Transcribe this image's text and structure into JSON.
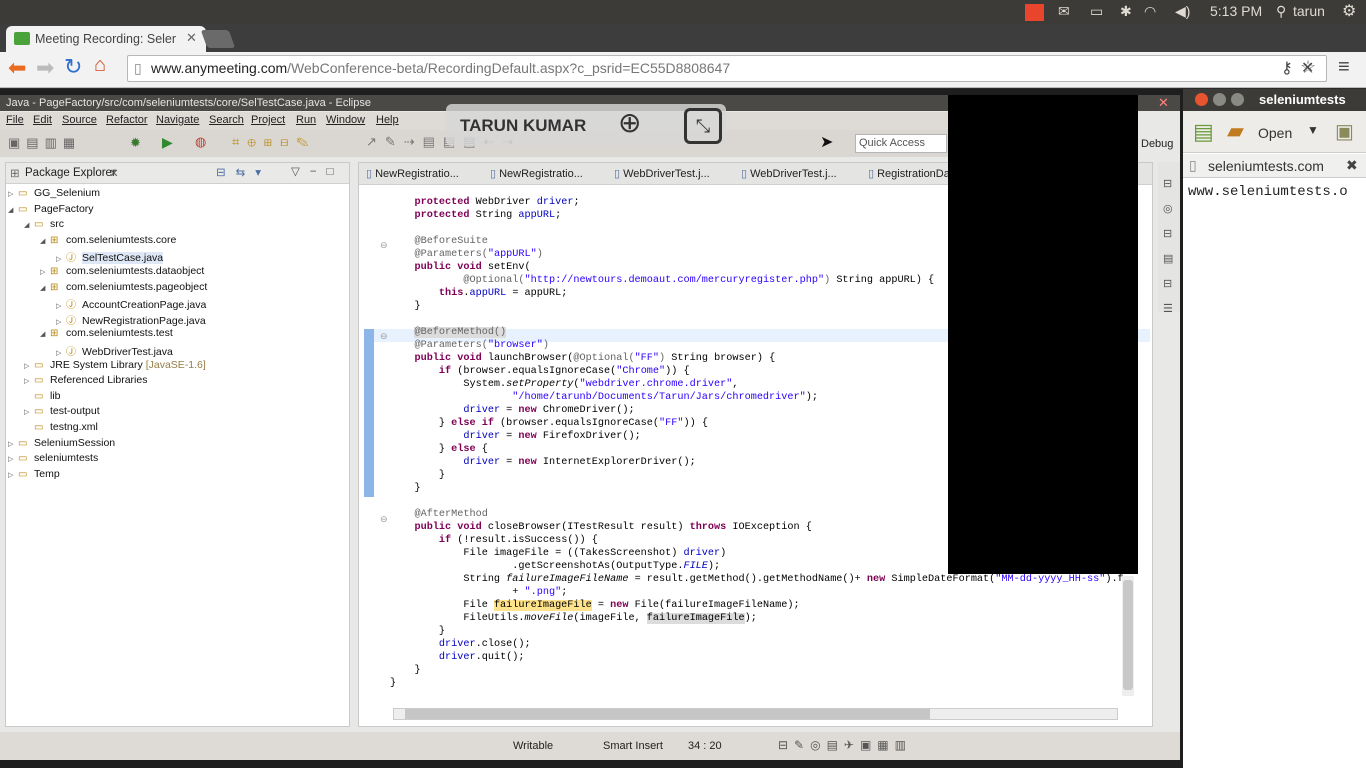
{
  "topbar": {
    "time": "5:13 PM",
    "user": "tarun"
  },
  "browser": {
    "tab_title": "Meeting Recording: Seler",
    "url_domain": "www.anymeeting.com",
    "url_path": "/WebConference-beta/RecordingDefault.aspx?c_psrid=EC55D8808647"
  },
  "eclipse": {
    "title": "Java - PageFactory/src/com/seleniumtests/core/SelTestCase.java - Eclipse",
    "menu": [
      "File",
      "Edit",
      "Source",
      "Refactor",
      "Navigate",
      "Search",
      "Project",
      "Run",
      "Window",
      "Help"
    ],
    "quick_access": "Quick Access",
    "perspective": "Debug",
    "package_explorer_title": "Package Explorer",
    "tree": [
      {
        "label": "GG_Selenium",
        "indent": 0,
        "expander": "▷"
      },
      {
        "label": "PageFactory",
        "indent": 0,
        "expander": "◢"
      },
      {
        "label": "src",
        "indent": 1,
        "expander": "◢"
      },
      {
        "label": "com.seleniumtests.core",
        "indent": 2,
        "expander": "◢"
      },
      {
        "label": "SelTestCase.java",
        "indent": 3,
        "expander": "▷",
        "selected": true
      },
      {
        "label": "com.seleniumtests.dataobject",
        "indent": 2,
        "expander": "▷"
      },
      {
        "label": "com.seleniumtests.pageobject",
        "indent": 2,
        "expander": "◢"
      },
      {
        "label": "AccountCreationPage.java",
        "indent": 3,
        "expander": "▷"
      },
      {
        "label": "NewRegistrationPage.java",
        "indent": 3,
        "expander": "▷"
      },
      {
        "label": "com.seleniumtests.test",
        "indent": 2,
        "expander": "◢"
      },
      {
        "label": "WebDriverTest.java",
        "indent": 3,
        "expander": "▷"
      },
      {
        "label": "JRE System Library",
        "suffix": "[JavaSE-1.6]",
        "indent": 1,
        "expander": "▷"
      },
      {
        "label": "Referenced Libraries",
        "indent": 1,
        "expander": "▷"
      },
      {
        "label": "lib",
        "indent": 1,
        "expander": ""
      },
      {
        "label": "test-output",
        "indent": 1,
        "expander": "▷"
      },
      {
        "label": "testng.xml",
        "indent": 1,
        "expander": ""
      },
      {
        "label": "SeleniumSession",
        "indent": 0,
        "expander": "▷"
      },
      {
        "label": "seleniumtests",
        "indent": 0,
        "expander": "▷"
      },
      {
        "label": "Temp",
        "indent": 0,
        "expander": "▷"
      }
    ],
    "editor_tabs": [
      "NewRegistratio...",
      "NewRegistratio...",
      "WebDriverTest.j...",
      "WebDriverTest.j...",
      "RegistrationDa"
    ],
    "status": {
      "mode": "Writable",
      "insert": "Smart Insert",
      "position": "34 : 20"
    }
  },
  "overlay": {
    "presenter": "TARUN KUMAR"
  },
  "gedit": {
    "title": "seleniumtests",
    "open_label": "Open",
    "tab_label": "seleniumtests.com",
    "text": "www.seleniumtests.o"
  }
}
